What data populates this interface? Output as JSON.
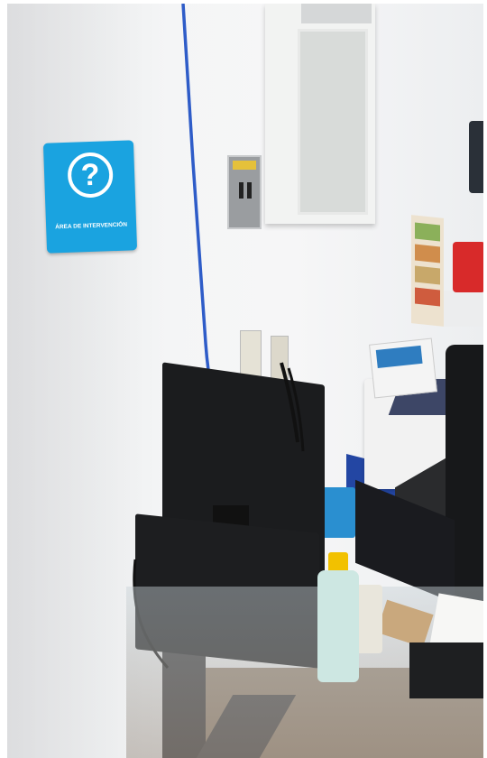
{
  "sign": {
    "symbol": "?",
    "text": "ÁREA DE INTERVENCIÓN"
  },
  "colors": {
    "sign_blue": "#1aa3e0",
    "wall": "#f2f3f4",
    "cable_blue": "#2e5cc8",
    "lotion_pump": "#f2c100",
    "bottle_red": "#d82a2a"
  }
}
